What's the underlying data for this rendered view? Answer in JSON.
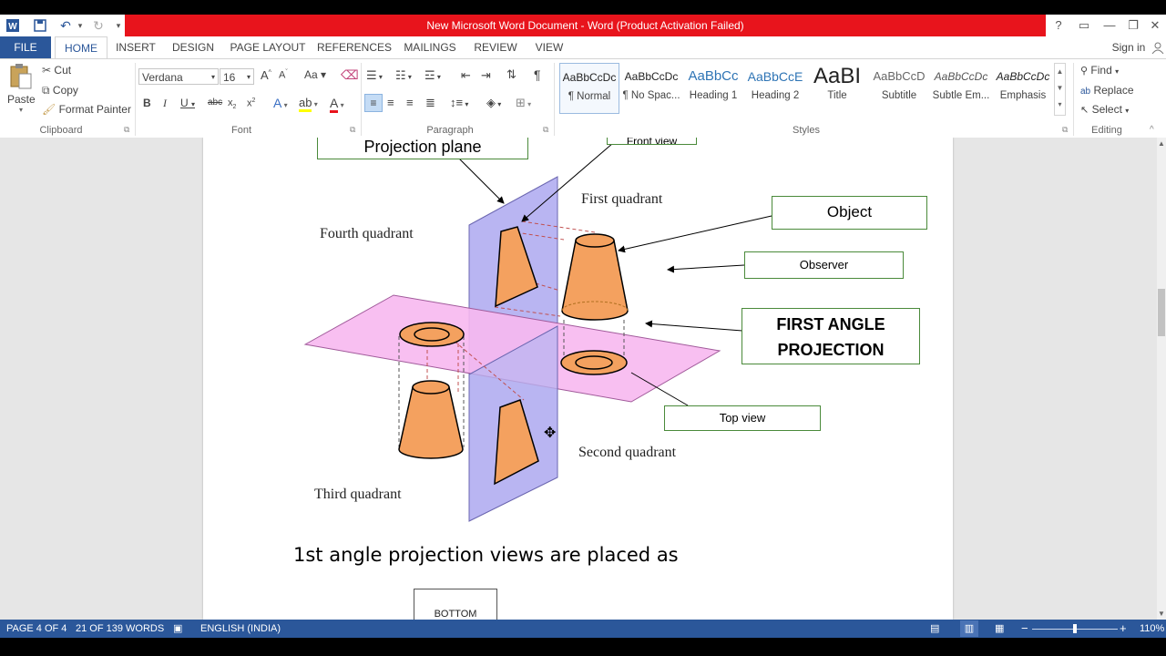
{
  "window": {
    "title": "New Microsoft Word Document -  Word (Product Activation Failed)",
    "help": "?",
    "sign_in": "Sign in"
  },
  "tabs": [
    "FILE",
    "HOME",
    "INSERT",
    "DESIGN",
    "PAGE LAYOUT",
    "REFERENCES",
    "MAILINGS",
    "REVIEW",
    "VIEW"
  ],
  "clipboard": {
    "paste": "Paste",
    "cut": "Cut",
    "copy": "Copy",
    "format_painter": "Format Painter",
    "label": "Clipboard"
  },
  "font": {
    "name": "Verdana",
    "size": "16",
    "label": "Font"
  },
  "paragraph": {
    "label": "Paragraph"
  },
  "styles": {
    "label": "Styles",
    "items": [
      {
        "preview": "AaBbCcDc",
        "name": "¶ Normal"
      },
      {
        "preview": "AaBbCcDc",
        "name": "¶ No Spac..."
      },
      {
        "preview": "AaBbCc",
        "name": "Heading 1"
      },
      {
        "preview": "AaBbCcE",
        "name": "Heading 2"
      },
      {
        "preview": "AaBI",
        "name": "Title"
      },
      {
        "preview": "AaBbCcD",
        "name": "Subtitle"
      },
      {
        "preview": "AaBbCcDc",
        "name": "Subtle Em..."
      },
      {
        "preview": "AaBbCcDc",
        "name": "Emphasis"
      }
    ]
  },
  "editing": {
    "find": "Find",
    "replace": "Replace",
    "select": "Select",
    "label": "Editing"
  },
  "diagram": {
    "projection_plane": "Projection plane",
    "front_view": "Front view",
    "first_quadrant": "First quadrant",
    "object": "Object",
    "fourth_quadrant": "Fourth quadrant",
    "observer": "Observer",
    "first_angle_line1": "FIRST ANGLE",
    "first_angle_line2": "PROJECTION",
    "top_view": "Top view",
    "second_quadrant": "Second quadrant",
    "third_quadrant": "Third quadrant"
  },
  "doc": {
    "heading": "1st angle projection views are placed as",
    "bottom_box": "BOTTOM"
  },
  "status": {
    "page": "PAGE 4 OF 4",
    "words": "21 OF 139 WORDS",
    "language": "ENGLISH (INDIA)",
    "zoom": "110%"
  },
  "colors": {
    "accent": "#2b579a",
    "title_red": "#e8141c",
    "vertical_plane": "#b8b4f0",
    "horizontal_plane": "#f6b6ef",
    "object_fill": "#f4a15f"
  }
}
